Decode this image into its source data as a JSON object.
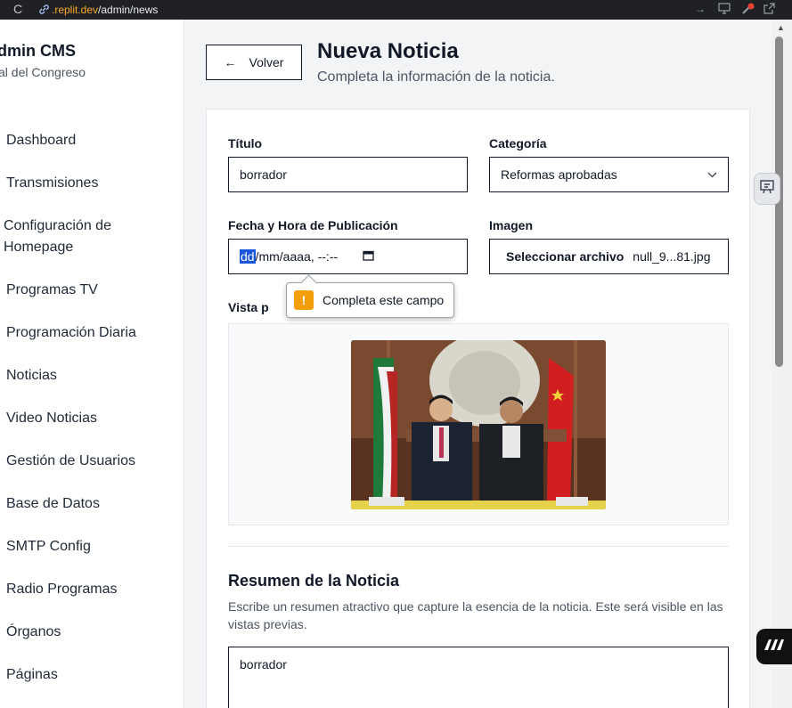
{
  "browser": {
    "reload_glyph": "C",
    "url_icon": "link-icon",
    "url_host": ".replit.dev",
    "url_path": "/admin/news"
  },
  "sidebar": {
    "brand_title": "dmin CMS",
    "brand_subtitle": "al del Congreso",
    "items": [
      {
        "label": "Dashboard"
      },
      {
        "label": "Transmisiones"
      },
      {
        "label": "Configuración de Homepage"
      },
      {
        "label": "Programas TV"
      },
      {
        "label": "Programación Diaria"
      },
      {
        "label": "Noticias"
      },
      {
        "label": "Video Noticias"
      },
      {
        "label": "Gestión de Usuarios"
      },
      {
        "label": "Base de Datos"
      },
      {
        "label": "SMTP Config"
      },
      {
        "label": "Radio Programas"
      },
      {
        "label": "Órganos"
      },
      {
        "label": "Páginas"
      }
    ]
  },
  "header": {
    "back_label": "Volver",
    "title": "Nueva Noticia",
    "subtitle": "Completa la información de la noticia."
  },
  "form": {
    "titulo_label": "Título",
    "titulo_value": "borrador",
    "categoria_label": "Categoría",
    "categoria_value": "Reformas aprobadas",
    "fecha_label": "Fecha y Hora de Publicación",
    "fecha_day": "dd",
    "fecha_rest": "/mm/aaaa, --:--",
    "imagen_label": "Imagen",
    "imagen_button": "Seleccionar archivo",
    "imagen_filename": "null_9...81.jpg",
    "preview_label": "Vista p",
    "validation_message": "Completa este campo",
    "validation_glyph": "!"
  },
  "summary": {
    "title": "Resumen de la Noticia",
    "description": "Escribe un resumen atractivo que capture la esencia de la noticia. Este será visible en las vistas previas.",
    "value": "borrador"
  },
  "colors": {
    "accent_selection": "#1a56db",
    "warning": "#f59e0b",
    "text_primary": "#111827",
    "text_secondary": "#4b5563"
  }
}
